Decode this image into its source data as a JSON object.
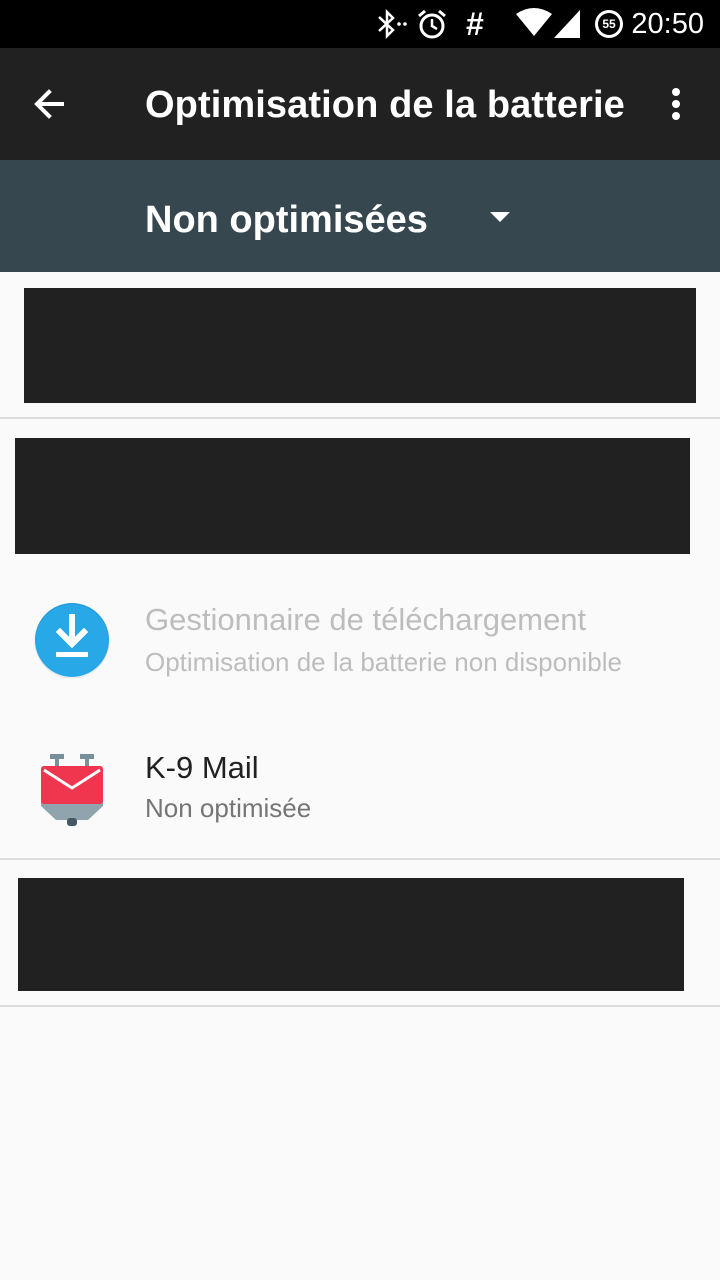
{
  "status_bar": {
    "time": "20:50",
    "battery_level": "55",
    "icons": [
      "bluetooth-icon",
      "alarm-icon",
      "hash-icon",
      "wifi-icon",
      "signal-icon",
      "battery-icon"
    ]
  },
  "toolbar": {
    "title": "Optimisation de la batterie",
    "back_icon": "arrow-back-icon",
    "menu_icon": "more-vert-icon"
  },
  "filter": {
    "selected": "Non optimisées"
  },
  "apps": [
    {
      "name": "Gestionnaire de téléchargement",
      "status": "Optimisation de la batterie non disponible",
      "icon": "download-manager-icon",
      "icon_color": "#29a8e8",
      "enabled": false
    },
    {
      "name": "K-9 Mail",
      "status": "Non optimisée",
      "icon": "k9-mail-icon",
      "icon_color": "#f0364f",
      "enabled": true
    }
  ],
  "colors": {
    "toolbar": "#212121",
    "filter_bar": "#37474f",
    "background": "#fafafa"
  }
}
